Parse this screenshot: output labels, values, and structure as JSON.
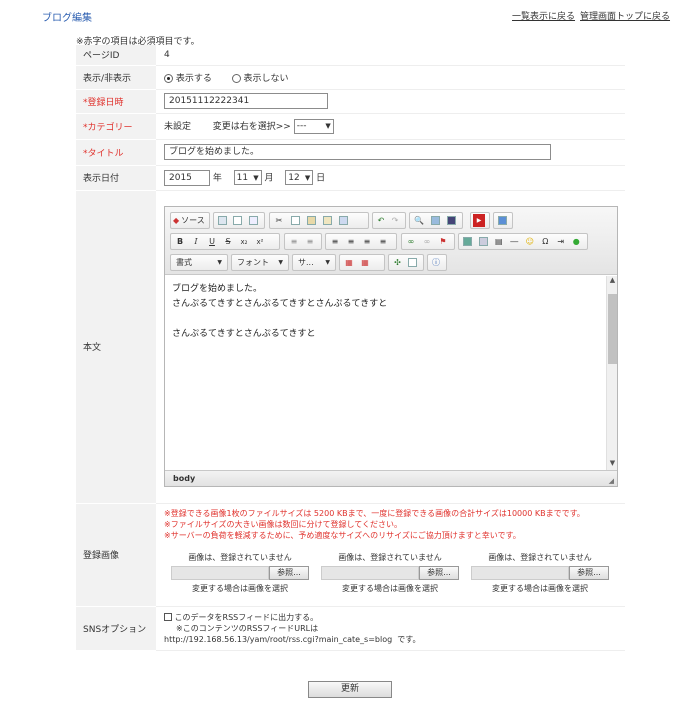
{
  "header": {
    "title": "ブログ編集",
    "links": [
      "一覧表示に戻る",
      "管理画面トップに戻る"
    ]
  },
  "note": "※赤字の項目は必須項目です。",
  "form": {
    "page_id": {
      "label": "ページID",
      "value": "4"
    },
    "visibility": {
      "label": "表示/非表示",
      "options": [
        "表示する",
        "表示しない"
      ],
      "selected": "表示する"
    },
    "registered": {
      "label": "*登録日時",
      "value": "20151112222341"
    },
    "category": {
      "label": "*カテゴリー",
      "current": "未設定",
      "hint": "変更は右を選択>>",
      "select_value": "---"
    },
    "title": {
      "label": "*タイトル",
      "value": "ブログを始めました。"
    },
    "display_date": {
      "label": "表示日付",
      "year": "2015",
      "year_unit": "年",
      "month": "11",
      "month_unit": "月",
      "day": "12",
      "day_unit": "日"
    },
    "body": {
      "label": "本文",
      "toolbar": {
        "source_label": "ソース",
        "format_label": "書式",
        "font_label": "フォント",
        "size_label": "サ..."
      },
      "lines": [
        "ブログを始めました。",
        "さんぷるてきすとさんぷるてきすとさんぷるてきすと",
        "",
        "さんぷるてきすとさんぷるてきすと"
      ],
      "status_path": "body"
    },
    "images": {
      "label": "登録画像",
      "notes": [
        "※登録できる画像1枚のファイルサイズは 5200 KBまで、一度に登録できる画像の合計サイズは10000 KBまでです。",
        "※ファイルサイズの大きい画像は数回に分けて登録してください。",
        "※サーバーの負荷を軽減するために、予め適度なサイズへのリサイズにご協力頂けますと幸いです。"
      ],
      "slots": [
        {
          "status": "画像は、登録されていません",
          "button": "参照...",
          "caption": "変更する場合は画像を選択"
        },
        {
          "status": "画像は、登録されていません",
          "button": "参照...",
          "caption": "変更する場合は画像を選択"
        },
        {
          "status": "画像は、登録されていません",
          "button": "参照...",
          "caption": "変更する場合は画像を選択"
        }
      ]
    },
    "sns": {
      "label": "SNSオプション",
      "checkbox_label": "このデータをRSSフィードに出力する。",
      "rss_note": "※このコンテンツのRSSフィードURLは",
      "rss_url": "http://192.168.56.13/yam/root/rss.cgi?main_cate_s=blog",
      "rss_suffix": "です。"
    }
  },
  "submit_label": "更新",
  "colors": {
    "title": "#2a5db0",
    "required": "#e0322d",
    "label_bg": "#f2f2f2"
  }
}
